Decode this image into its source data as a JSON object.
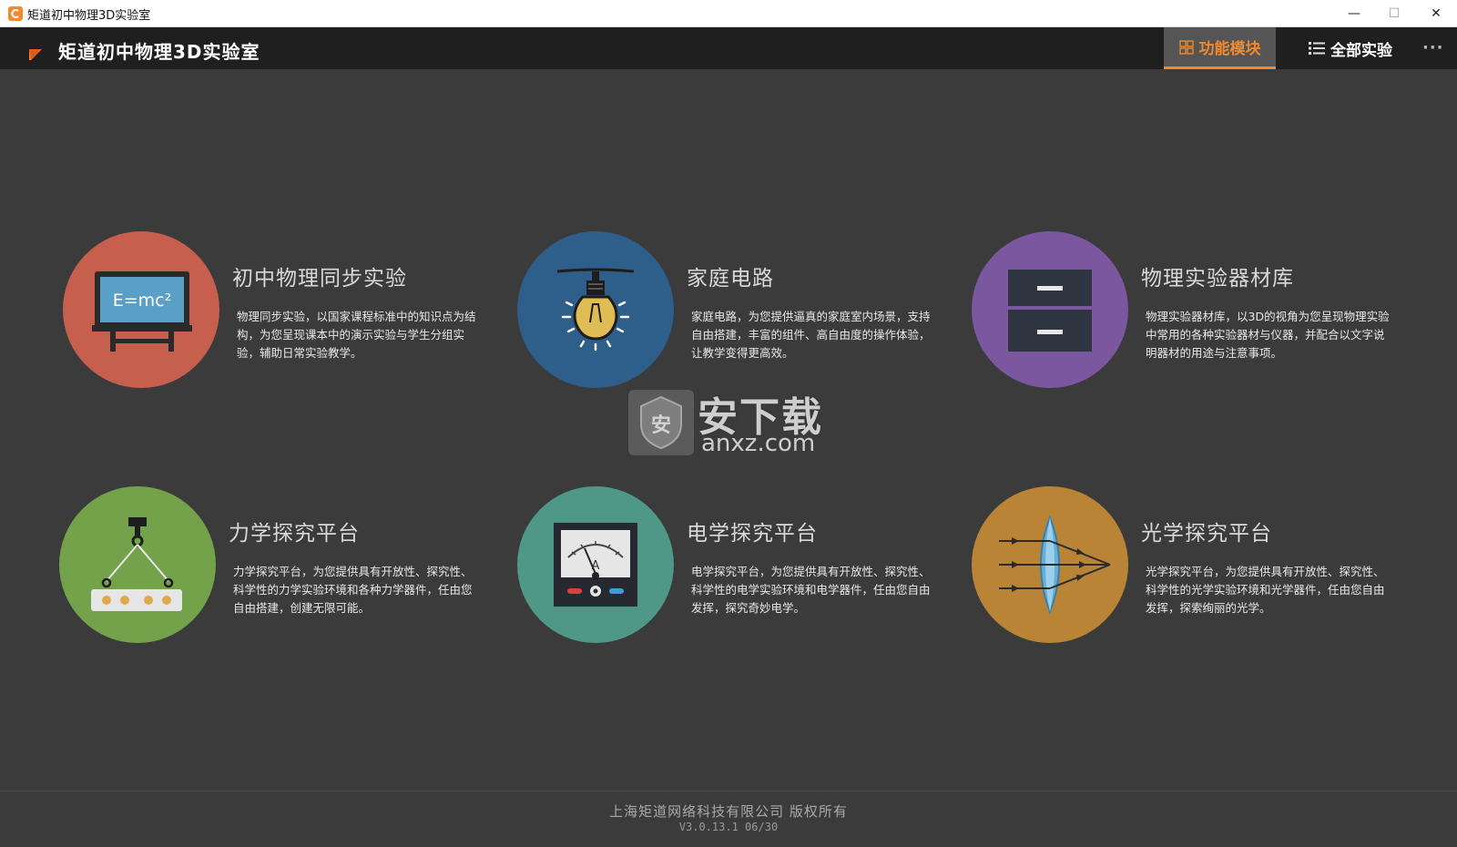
{
  "window": {
    "title": "矩道初中物理3D实验室",
    "minimize_glyph": "—",
    "maximize_glyph": "☐",
    "close_glyph": "✕"
  },
  "appbar": {
    "title": "矩道初中物理3D实验室",
    "tabs": [
      {
        "label": "功能模块",
        "icon": "grid-icon",
        "active": true
      },
      {
        "label": "全部实验",
        "icon": "list-icon",
        "active": false
      }
    ],
    "more_glyph": "···"
  },
  "colors": {
    "accent": "#f08a2e",
    "background": "#3b3b3b",
    "appbar": "#1f1f1f",
    "card_sync": "#c75f4e",
    "card_circuit": "#2d5f8a",
    "card_equipment": "#7a579e",
    "card_mechanics": "#73a24a",
    "card_electric": "#4f9888",
    "card_optics": "#b98436"
  },
  "modules": [
    {
      "title": "初中物理同步实验",
      "desc": "物理同步实验，以国家课程标准中的知识点为结构，为您呈现课本中的演示实验与学生分组实验，辅助日常实验教学。",
      "icon": "blackboard-icon",
      "board_text": "E=mc²"
    },
    {
      "title": "家庭电路",
      "desc": "家庭电路，为您提供逼真的家庭室内场景，支持自由搭建，丰富的组件、高自由度的操作体验，让教学变得更高效。",
      "icon": "light-bulb-icon"
    },
    {
      "title": "物理实验器材库",
      "desc": "物理实验器材库，以3D的视角为您呈现物理实验中常用的各种实验器材与仪器，并配合以文字说明器材的用途与注意事项。",
      "icon": "cabinet-icon"
    },
    {
      "title": "力学探究平台",
      "desc": "力学探究平台，为您提供具有开放性、探究性、科学性的力学实验环境和各种力学器件，任由您自由搭建，创建无限可能。",
      "icon": "crane-hook-icon"
    },
    {
      "title": "电学探究平台",
      "desc": "电学探究平台，为您提供具有开放性、探究性、科学性的电学实验环境和电学器件，任由您自由发挥，探究奇妙电学。",
      "icon": "ammeter-icon",
      "meter_text": "A"
    },
    {
      "title": "光学探究平台",
      "desc": "光学探究平台，为您提供具有开放性、探究性、科学性的光学实验环境和光学器件，任由您自由发挥，探索绚丽的光学。",
      "icon": "lens-icon"
    }
  ],
  "footer": {
    "copyright": "上海矩道网络科技有限公司 版权所有",
    "version": "V3.0.13.1 06/30"
  },
  "watermark": {
    "text": "安下载",
    "url": "anxz.com",
    "shield_char": "安"
  }
}
